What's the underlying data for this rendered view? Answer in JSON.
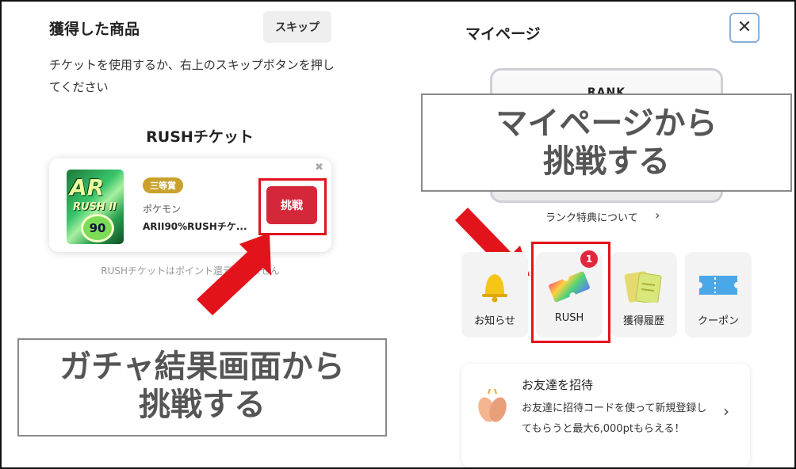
{
  "left": {
    "title": "獲得した商品",
    "skip_label": "スキップ",
    "description": "チケットを使用するか、右上のスキップボタンを押してください",
    "section_heading": "RUSHチケット",
    "ticket": {
      "badge": "三等賞",
      "category": "ポケモン",
      "name": "ARII90%RUSHチケ...",
      "thumb_ar": "AR",
      "thumb_rush": "RUSH II",
      "thumb_num": "90",
      "close_glyph": "✖"
    },
    "challenge_label": "挑戦",
    "note": "RUSHチケットはポイント還元できません"
  },
  "callouts": {
    "left_line1": "ガチャ結果画面から",
    "left_line2": "挑戦する",
    "right_line1": "マイページから",
    "right_line2": "挑戦する"
  },
  "right": {
    "title": "マイページ",
    "close_glyph": "✕",
    "rank_label": "RANK",
    "rank_link": "ランク特典について",
    "chevron": "›",
    "tiles": [
      {
        "label": "お知らせ",
        "icon": "bell-icon"
      },
      {
        "label": "RUSH",
        "icon": "ticket-icon",
        "badge": "1"
      },
      {
        "label": "獲得履歴",
        "icon": "cards-icon"
      },
      {
        "label": "クーポン",
        "icon": "coupon-icon"
      }
    ],
    "friend": {
      "title": "お友達を招待",
      "description": "お友達に招待コードを使って新規登録してもらうと最大6,000ptもらえる！"
    }
  },
  "colors": {
    "highlight_red": "#e3131b",
    "challenge_button": "#d4283a",
    "badge_gold": "#c9a12c",
    "callout_text": "#555555"
  }
}
